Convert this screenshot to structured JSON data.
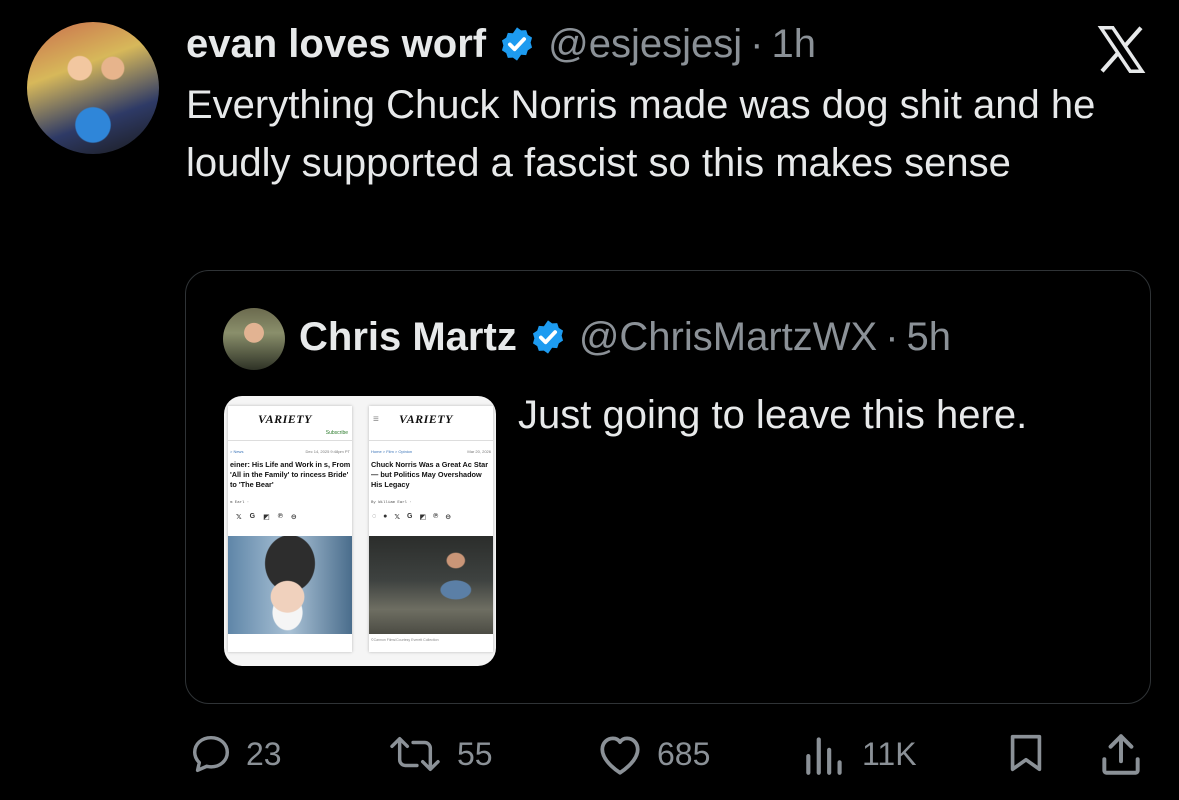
{
  "tweet": {
    "author_name": "evan loves worf",
    "handle": "@esjesjesj",
    "separator": "·",
    "time": "1h",
    "text": "Everything Chuck Norris made was dog shit and he loudly supported a fascist so this makes sense"
  },
  "quote": {
    "author_name": "Chris Martz",
    "handle": "@ChrisMartzWX",
    "separator": "·",
    "time": "5h",
    "text": "Just going to leave this here.",
    "image": {
      "article1": {
        "masthead": "VARIETY",
        "subscribe": "Subscribe",
        "crumb": "> News",
        "date": "Dec 14, 2025 9:48pm PT",
        "headline": "einer: His Life and Work in s, From 'All in the Family' to rincess Bride' to 'The Bear'",
        "byline": "m Earl ·"
      },
      "article2": {
        "masthead": "VARIETY",
        "menu": "≡",
        "crumb": "Home > Film > Opinion",
        "date": "Mar 20, 2026",
        "headline": "Chuck Norris Was a Great Ac Star — but Politics May Overshadow His Legacy",
        "byline": "By William Earl ·",
        "credit": "©Cannon Films/Courtesy Everett Collection"
      }
    }
  },
  "actions": {
    "replies": "23",
    "reposts": "55",
    "likes": "685",
    "views": "11K"
  },
  "colors": {
    "background": "#000000",
    "text": "#e7e9ea",
    "muted": "#8b9197",
    "verified": "#1d9bf0",
    "border": "#2f3336"
  }
}
